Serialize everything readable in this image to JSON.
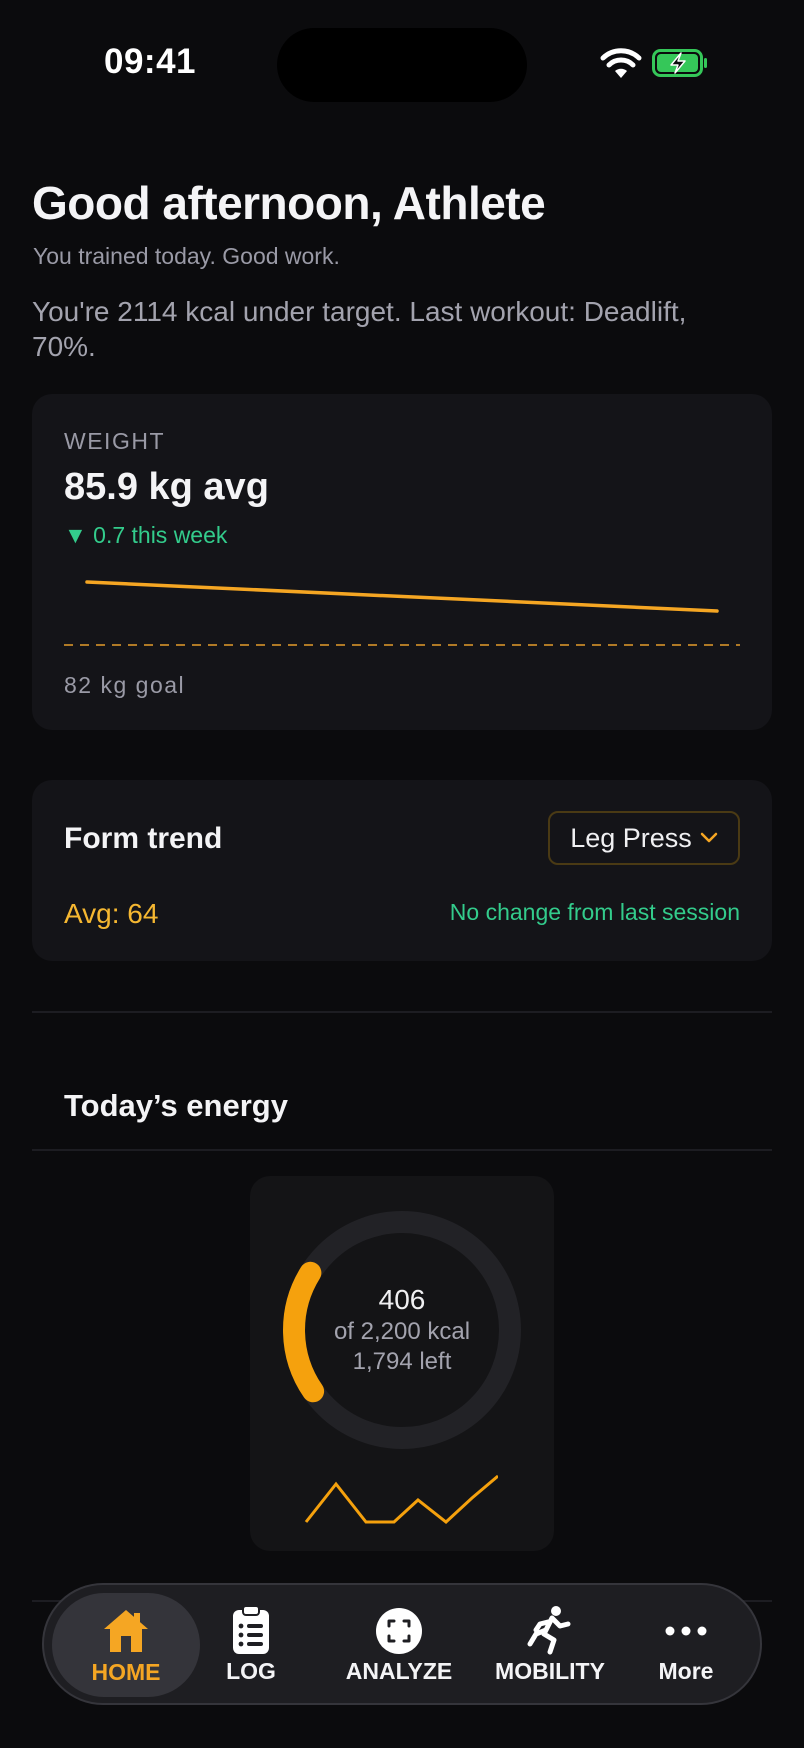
{
  "status_bar": {
    "time": "09:41"
  },
  "header": {
    "greeting": "Good afternoon, Athlete",
    "subline": "You trained today. Good work.",
    "summary": "You're 2114 kcal under target. Last workout: Deadlift, 70%."
  },
  "weight_card": {
    "label": "WEIGHT",
    "value": "85.9 kg avg",
    "delta": "▼ 0.7 this week",
    "goal": "82 kg goal",
    "accent_color": "#f5a623",
    "trend_color": "#33cc8c"
  },
  "form_card": {
    "title": "Form trend",
    "selected_exercise": "Leg Press",
    "avg": "Avg: 64",
    "change": "No change from last session"
  },
  "energy": {
    "title": "Today’s energy",
    "consumed": "406",
    "target_text": "of 2,200 kcal",
    "left_text": "1,794 left",
    "progress_fraction": 0.185
  },
  "tab_bar": {
    "tabs": [
      {
        "label": "HOME",
        "icon": "home-icon",
        "active": true
      },
      {
        "label": "LOG",
        "icon": "clipboard-icon",
        "active": false
      },
      {
        "label": "ANALYZE",
        "icon": "scan-icon",
        "active": false
      },
      {
        "label": "MOBILITY",
        "icon": "running-person-icon",
        "active": false
      },
      {
        "label": "More",
        "icon": "more-dots-icon",
        "active": false
      }
    ]
  }
}
